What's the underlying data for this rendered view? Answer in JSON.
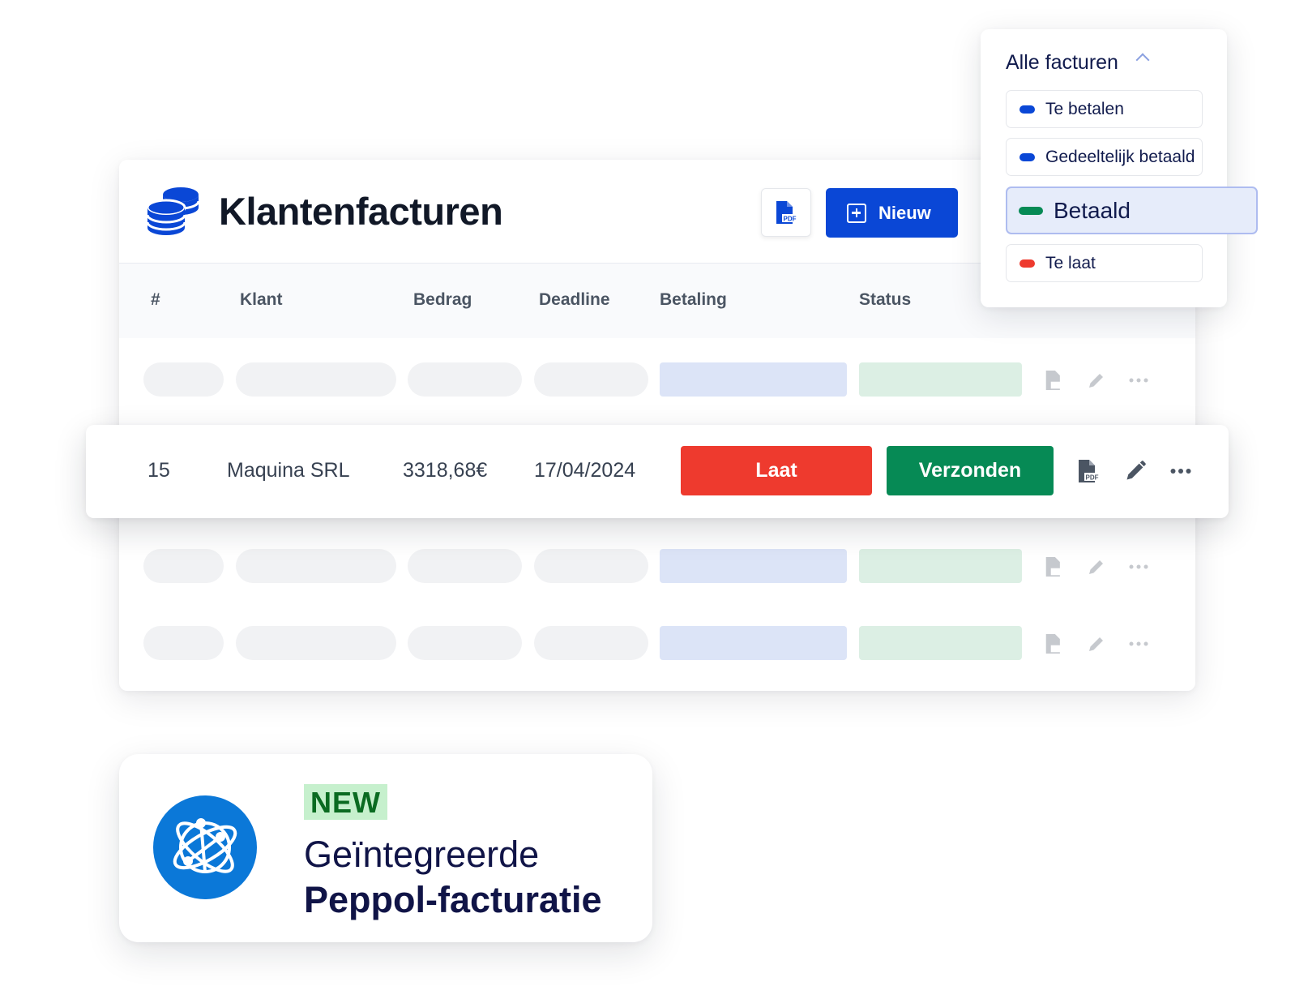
{
  "header": {
    "title": "Klantenfacturen",
    "new_button_label": "Nieuw",
    "pdf_icon_text": "PDF"
  },
  "table": {
    "columns": [
      "#",
      "Klant",
      "Bedrag",
      "Deadline",
      "Betaling",
      "Status"
    ],
    "highlighted_row": {
      "number": "15",
      "client": "Maquina SRL",
      "amount": "3318,68€",
      "deadline": "17/04/2024",
      "payment": "Laat",
      "status": "Verzonden"
    }
  },
  "filter": {
    "title": "Alle facturen",
    "options": [
      {
        "label": "Te betalen",
        "color": "#0a47d6"
      },
      {
        "label": "Gedeeltelijk betaald",
        "color": "#0a47d6"
      },
      {
        "label": "Betaald",
        "color": "#068a55"
      },
      {
        "label": "Te laat",
        "color": "#ee3a2e"
      }
    ],
    "selected": "Betaald"
  },
  "promo": {
    "badge": "NEW",
    "line1": "Geïntegreerde",
    "line2": "Peppol-facturatie"
  },
  "colors": {
    "primary": "#0a47d6",
    "late": "#ee3a2e",
    "sent": "#068a55",
    "new_badge_bg": "#c6f0cd",
    "globe_bg": "#0b78d8"
  },
  "icons": [
    "coins-icon",
    "pdf-icon",
    "plus-icon",
    "pencil-icon",
    "more-icon",
    "chevron-up-icon",
    "globe-network-icon"
  ]
}
